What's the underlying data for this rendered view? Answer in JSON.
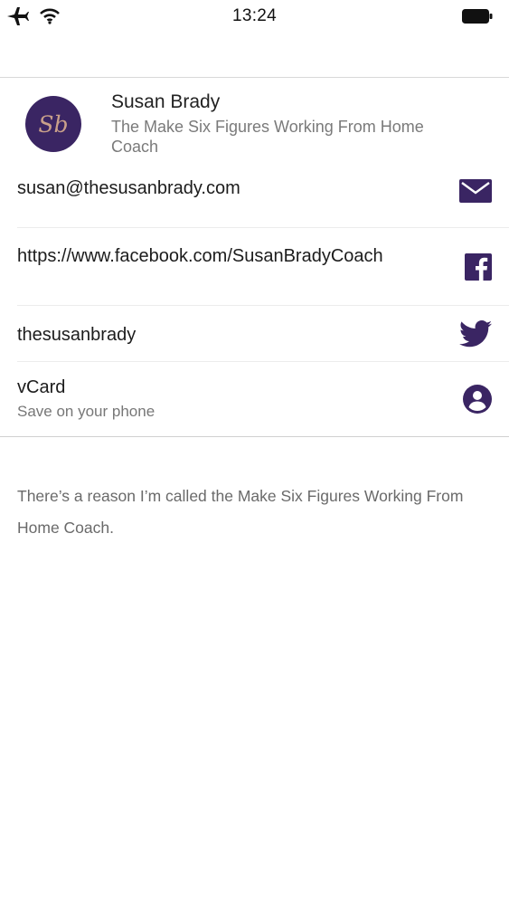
{
  "status_bar": {
    "time": "13:24",
    "left_icons": [
      "airplane-icon",
      "wifi-icon"
    ],
    "right_icons": [
      "battery-icon"
    ]
  },
  "profile": {
    "avatar_initials": "Sb",
    "name": "Susan Brady",
    "subtitle": "The Make Six Figures Working From Home Coach"
  },
  "contacts": {
    "email": {
      "text": "susan@thesusanbrady.com",
      "icon": "mail-icon"
    },
    "facebook": {
      "text": "https://www.facebook.com/SusanBradyCoach",
      "icon": "facebook-icon"
    },
    "twitter": {
      "text": "thesusanbrady",
      "icon": "twitter-icon"
    },
    "vcard": {
      "text": "vCard",
      "subtext": "Save on your phone",
      "icon": "person-icon"
    }
  },
  "description": "There’s a reason I’m called the Make Six Figures Working From Home Coach.",
  "colors": {
    "accent": "#3a2563",
    "avatar_text": "#c9a08a"
  }
}
